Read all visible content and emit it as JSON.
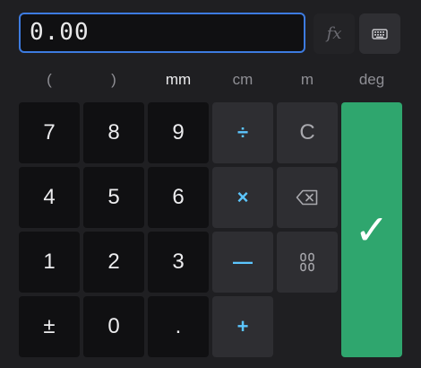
{
  "display": {
    "value": "0.00"
  },
  "toolbar": {
    "fx_label": "fx",
    "keyboard_icon": "keyboard-icon"
  },
  "units": [
    "(",
    ")",
    "mm",
    "cm",
    "m",
    "deg"
  ],
  "keys": {
    "seven": "7",
    "eight": "8",
    "nine": "9",
    "four": "4",
    "five": "5",
    "six": "6",
    "one": "1",
    "two": "2",
    "three": "3",
    "plus_minus": "±",
    "zero": "0",
    "decimal": ".",
    "divide": "÷",
    "multiply": "×",
    "subtract": "—",
    "add": "+",
    "clear": "C",
    "backspace_icon": "backspace-icon",
    "link_icon": "link-icon",
    "enter": "✓"
  },
  "colors": {
    "accent": "#3d7be0",
    "operator": "#5cc6ff",
    "confirm": "#2fa66e"
  }
}
